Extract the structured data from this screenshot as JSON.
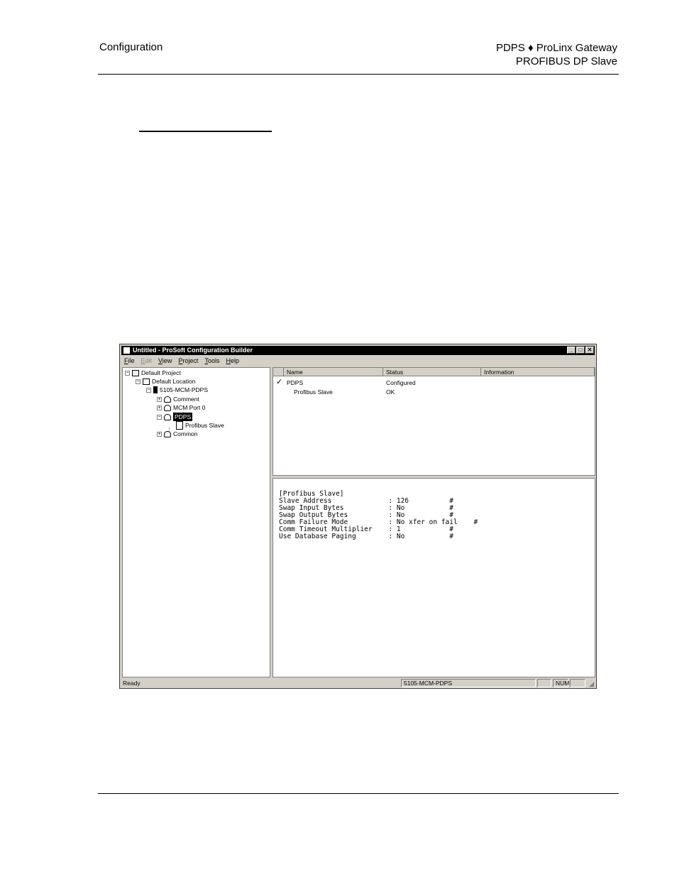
{
  "header": {
    "left": "Configuration",
    "right_line1": "PDPS ♦ ProLinx Gateway",
    "right_line2": "PROFIBUS DP Slave"
  },
  "window": {
    "title": "Untitled - ProSoft Configuration Builder",
    "minimize": "_",
    "maximize": "□",
    "close": "✕"
  },
  "menu": [
    "File",
    "Edit",
    "View",
    "Project",
    "Tools",
    "Help"
  ],
  "tree": {
    "project": "Default Project",
    "location": "Default Location",
    "module": "5105-MCM-PDPS",
    "comment": "Comment",
    "port": "MCM Port 0",
    "pdps": "PDPS",
    "profibus_slave": "Profibus Slave",
    "common": "Common"
  },
  "list": {
    "col_name": "Name",
    "col_status": "Status",
    "col_info": "Information",
    "rows": [
      {
        "mark": "✓",
        "name": "PDPS",
        "status": "Configured"
      },
      {
        "mark": "",
        "name": "Profibus Slave",
        "status": "OK"
      }
    ]
  },
  "editor": {
    "text": "[Profibus Slave]\nSlave Address              : 126          #\nSwap Input Bytes           : No           #\nSwap Output Bytes          : No           #\nComm Failure Mode          : No xfer on fail    #\nComm Timeout Multiplier    : 1            #\nUse Database Paging        : No           #"
  },
  "status": {
    "ready": "Ready",
    "module": "5105-MCM-PDPS",
    "num": "NUM"
  }
}
